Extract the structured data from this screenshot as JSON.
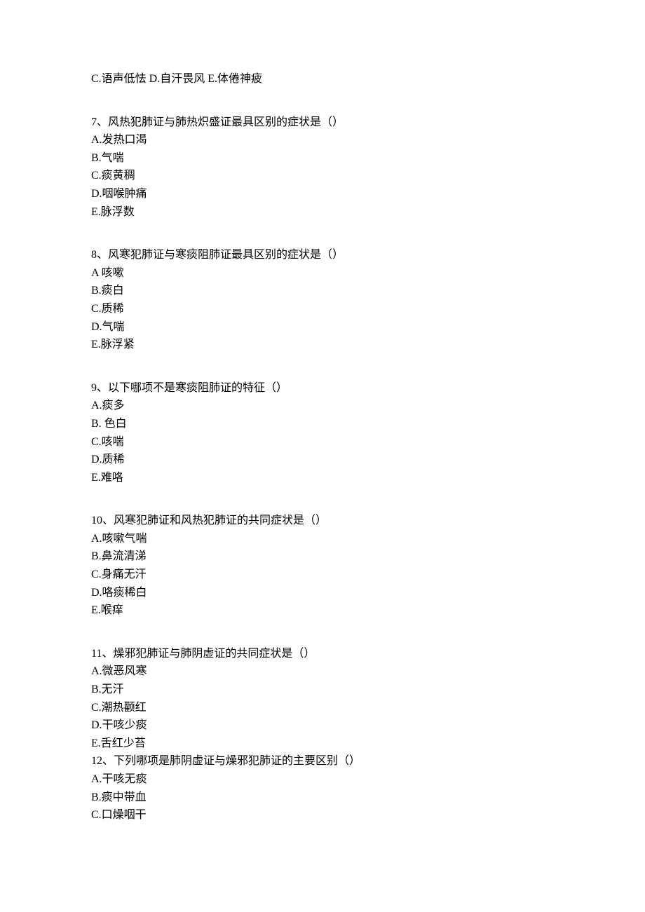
{
  "q6_tail": {
    "part1": "C.语声低怯 D.自汗畏风 E.体倦神疲"
  },
  "q7": {
    "stem": "7、风热犯肺证与肺热炽盛证最具区别的症状是（）",
    "opts": [
      "A.发热口渴",
      "B.气喘",
      "C.痰黄稠",
      "D.咽喉肿痛",
      "E.脉浮数"
    ]
  },
  "q8": {
    "stem": "8、风寒犯肺证与寒痰阻肺证最具区别的症状是（）",
    "opts": [
      "A 咳嗽",
      "B.痰白",
      "C.质稀",
      "D.气喘",
      "E.脉浮紧"
    ]
  },
  "q9": {
    "stem": "9、以下哪项不是寒痰阻肺证的特征（）",
    "opts": [
      "A.痰多",
      "B. 色白",
      "C.咳喘",
      "D.质稀",
      "E.难咯"
    ]
  },
  "q10": {
    "stem": "10、风寒犯肺证和风热犯肺证的共同症状是（）",
    "opts": [
      "A.咳嗽气喘",
      "B.鼻流清涕",
      "C.身痛无汗",
      "D.咯痰稀白",
      "E.喉痒"
    ]
  },
  "q11": {
    "stem": "11、燥邪犯肺证与肺阴虚证的共同症状是（）",
    "opts": [
      "A.微恶风寒",
      "B.无汗",
      "C.潮热颧红",
      "D.干咳少痰",
      "E.舌红少苔"
    ]
  },
  "q12": {
    "stem": "12、下列哪项是肺阴虚证与燥邪犯肺证的主要区别（）",
    "opts": [
      "A.干咳无痰",
      "B.痰中带血",
      "C.口燥咽干"
    ]
  }
}
